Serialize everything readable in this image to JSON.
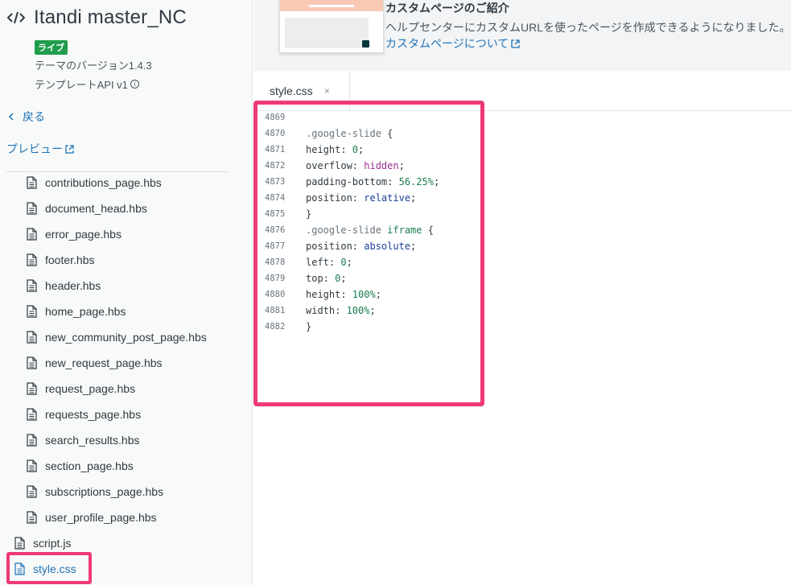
{
  "sidebar": {
    "theme_title": "Itandi master_NC",
    "live_badge": "ライブ",
    "theme_version": "テーマのバージョン1.4.3",
    "template_api": "テンプレートAPI v1",
    "back_label": "戻る",
    "preview_label": "プレビュー",
    "files": [
      {
        "name": "contributions_page.hbs"
      },
      {
        "name": "document_head.hbs"
      },
      {
        "name": "error_page.hbs"
      },
      {
        "name": "footer.hbs"
      },
      {
        "name": "header.hbs"
      },
      {
        "name": "home_page.hbs"
      },
      {
        "name": "new_community_post_page.hbs"
      },
      {
        "name": "new_request_page.hbs"
      },
      {
        "name": "request_page.hbs"
      },
      {
        "name": "requests_page.hbs"
      },
      {
        "name": "search_results.hbs"
      },
      {
        "name": "section_page.hbs"
      },
      {
        "name": "subscriptions_page.hbs"
      },
      {
        "name": "user_profile_page.hbs"
      }
    ],
    "root_files": [
      {
        "name": "script.js"
      },
      {
        "name": "style.css",
        "active": true
      }
    ]
  },
  "promo": {
    "title": "カスタムページのご紹介",
    "description": "ヘルプセンターにカスタムURLを使ったページを作成できるようになりました。",
    "link_label": "カスタムページについて"
  },
  "tabs": [
    {
      "label": "style.css",
      "close": "×"
    }
  ],
  "editor": {
    "lines": [
      {
        "no": "4869",
        "text": ""
      },
      {
        "no": "4870",
        "text": ".google-slide {"
      },
      {
        "no": "4871",
        "text": "height: 0;"
      },
      {
        "no": "4872",
        "text": "overflow: hidden;"
      },
      {
        "no": "4873",
        "text": "padding-bottom: 56.25%;"
      },
      {
        "no": "4874",
        "text": "position: relative;"
      },
      {
        "no": "4875",
        "text": "}"
      },
      {
        "no": "4876",
        "text": ".google-slide iframe {"
      },
      {
        "no": "4877",
        "text": "position: absolute;"
      },
      {
        "no": "4878",
        "text": "left: 0;"
      },
      {
        "no": "4879",
        "text": "top: 0;"
      },
      {
        "no": "4880",
        "text": "height: 100%;"
      },
      {
        "no": "4881",
        "text": "width: 100%;"
      },
      {
        "no": "4882",
        "text": "}"
      }
    ]
  },
  "colors": {
    "link": "#1f73b7",
    "live_badge": "#1f9d4b",
    "annotation": "#ee3a75"
  }
}
